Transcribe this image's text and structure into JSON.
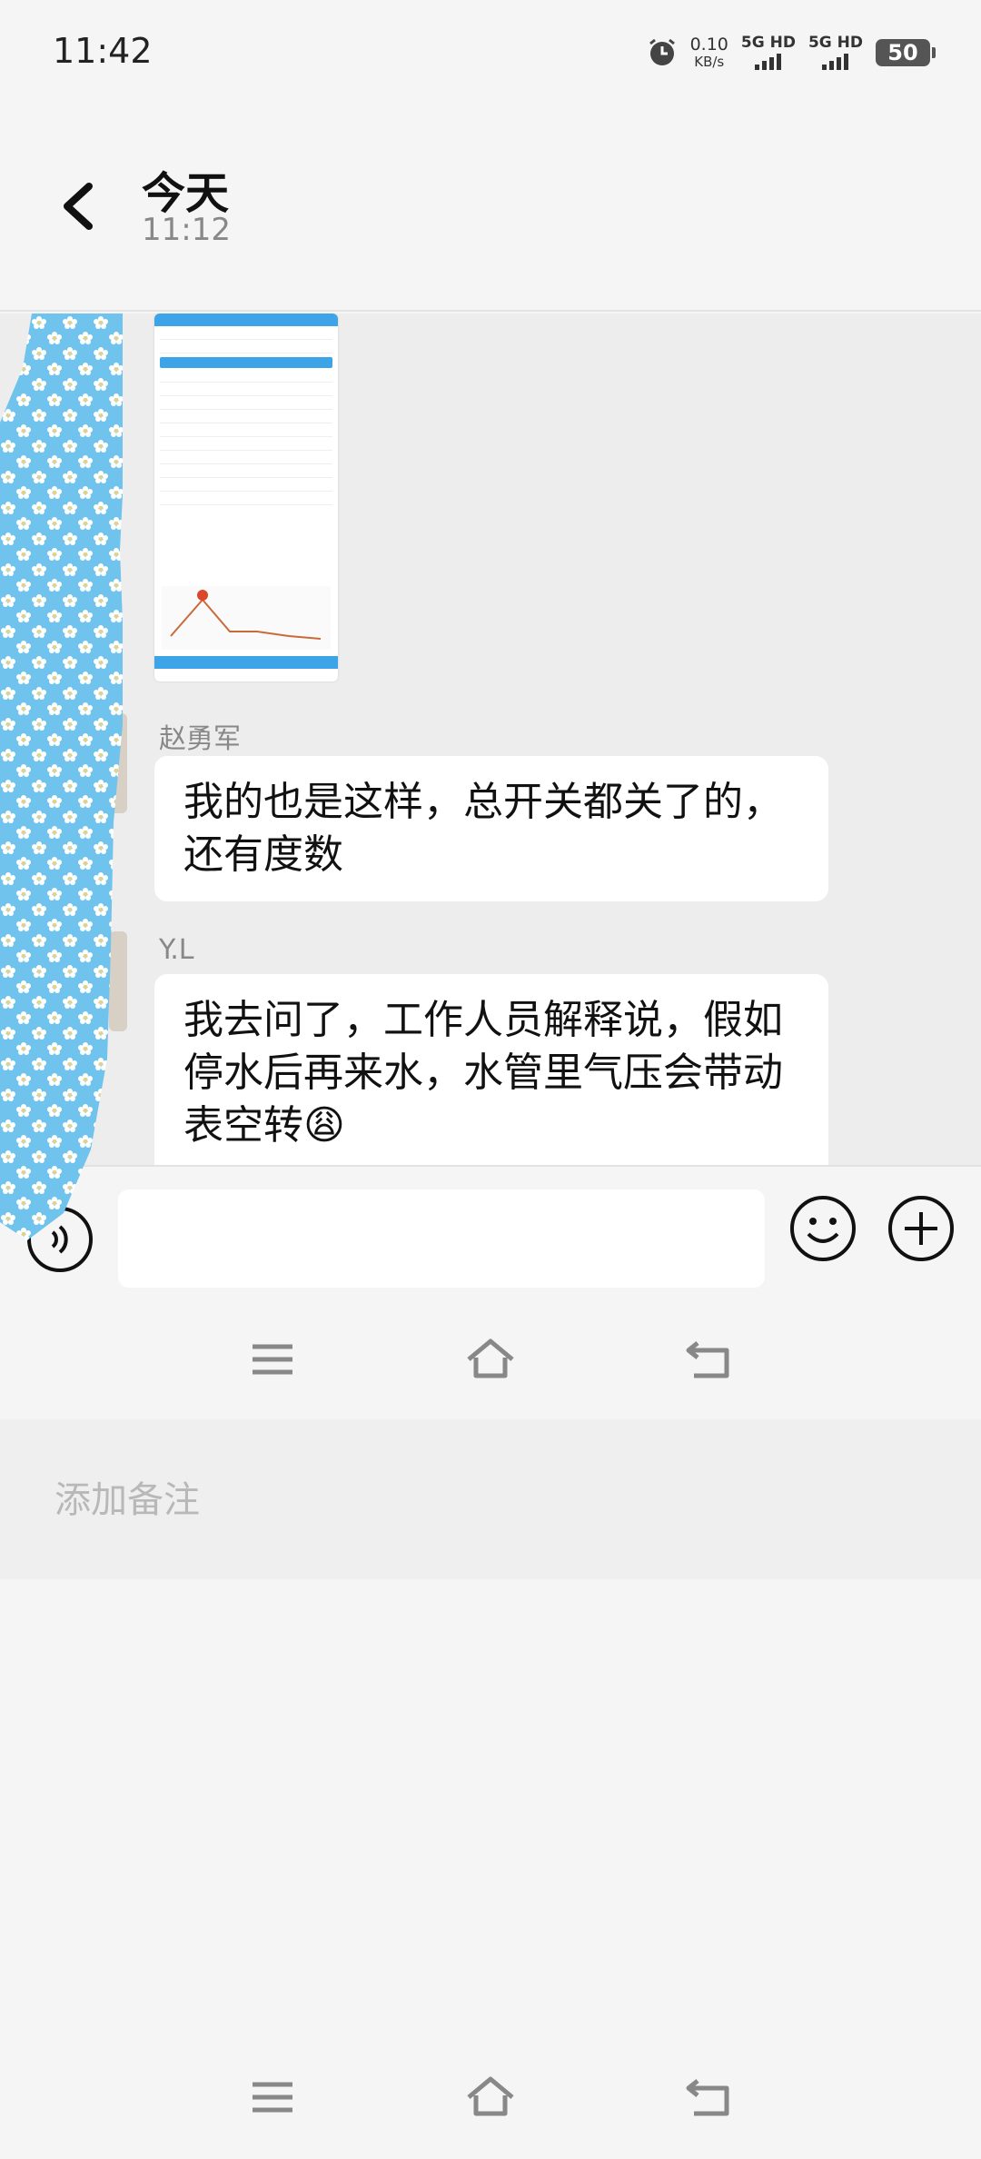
{
  "status_bar": {
    "time": "11:42",
    "speed_value": "0.10",
    "speed_unit": "KB/s",
    "sim1_label": "5G HD",
    "sim2_label": "5G HD",
    "battery": "50",
    "icons": [
      "alarm-icon",
      "signal-icon",
      "battery-icon"
    ]
  },
  "header": {
    "title": "今天",
    "subtitle": "11:12",
    "back_icon": "chevron-left-icon"
  },
  "messages": [
    {
      "type": "image",
      "description_icon": "screenshot-thumbnail"
    },
    {
      "type": "text",
      "sender": "赵勇军",
      "text": "我的也是这样，总开关都关了的，还有度数"
    },
    {
      "type": "text",
      "sender": "Y.L",
      "text": "我去问了，工作人员解释说，假如停水后再来水，水管里气压会带动表空转😩"
    }
  ],
  "input_bar": {
    "placeholder": "",
    "icons": [
      "voice-icon",
      "emoji-icon",
      "plus-icon"
    ]
  },
  "nav_bar": {
    "icons": [
      "menu-icon",
      "home-icon",
      "back-icon"
    ]
  },
  "note": {
    "placeholder": "添加备注"
  },
  "colors": {
    "chat_bg": "#ededed",
    "bubble_bg": "#ffffff",
    "blob_fill": "#6fc3ec",
    "accent_blue": "#3ea4e8"
  }
}
